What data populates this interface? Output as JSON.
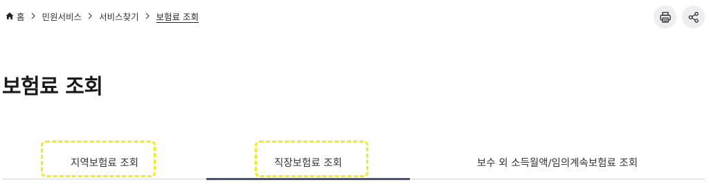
{
  "breadcrumb": {
    "items": [
      {
        "label": "홈"
      },
      {
        "label": "민원서비스"
      },
      {
        "label": "서비스찾기"
      },
      {
        "label": "보험료 조회"
      }
    ]
  },
  "toolbar": {
    "print_icon": "printer-icon",
    "share_icon": "share-icon"
  },
  "title": "보험료 조회",
  "tabs": [
    {
      "label": "지역보험료 조회",
      "active": false
    },
    {
      "label": "직장보험료 조회",
      "active": true
    },
    {
      "label": "보수 외 소득월액/임의계속보험료 조회",
      "active": false
    }
  ],
  "colors": {
    "active_tab_underline": "#4a4e78",
    "highlight_dash": "#f0ee1a",
    "tool_button_bg": "#eeeef1"
  }
}
